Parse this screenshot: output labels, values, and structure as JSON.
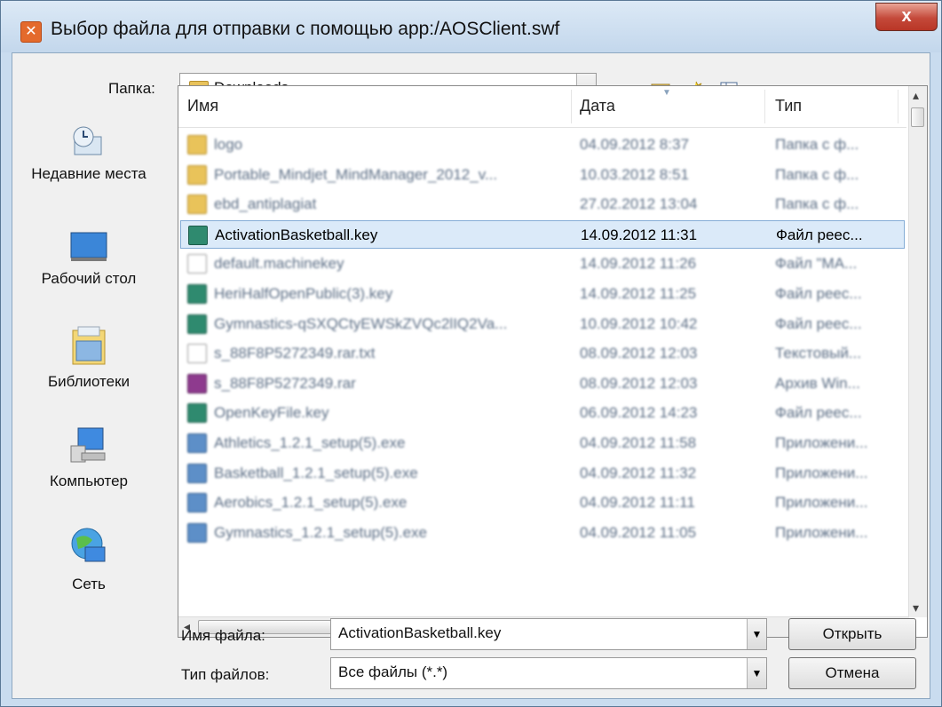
{
  "window": {
    "title": "Выбор файла для отправки с помощью app:/AOSClient.swf",
    "close_glyph": "x"
  },
  "toolbar": {
    "folder_label": "Папка:",
    "folder_value": "Downloads",
    "icons": [
      "back-arrow-icon",
      "up-folder-icon",
      "new-folder-icon",
      "view-menu-icon"
    ]
  },
  "places": [
    {
      "label": "Недавние места",
      "icon": "recent-places-icon"
    },
    {
      "label": "Рабочий стол",
      "icon": "desktop-icon"
    },
    {
      "label": "Библиотеки",
      "icon": "libraries-icon"
    },
    {
      "label": "Компьютер",
      "icon": "computer-icon"
    },
    {
      "label": "Сеть",
      "icon": "network-icon"
    }
  ],
  "columns": {
    "name": "Имя",
    "date": "Дата",
    "type": "Тип"
  },
  "files": [
    {
      "name": "logo",
      "date": "04.09.2012 8:37",
      "type": "Папка с ф...",
      "kind": "folder",
      "selected": false
    },
    {
      "name": "Portable_Mindjet_MindManager_2012_v...",
      "date": "10.03.2012 8:51",
      "type": "Папка с ф...",
      "kind": "folder",
      "selected": false
    },
    {
      "name": "ebd_antiplagiat",
      "date": "27.02.2012 13:04",
      "type": "Папка с ф...",
      "kind": "folder",
      "selected": false
    },
    {
      "name": "ActivationBasketball.key",
      "date": "14.09.2012 11:31",
      "type": "Файл реес...",
      "kind": "reg",
      "selected": true
    },
    {
      "name": "default.machinekey",
      "date": "14.09.2012 11:26",
      "type": "Файл \"MA...",
      "kind": "doc",
      "selected": false
    },
    {
      "name": "HeriHalfOpenPublic(3).key",
      "date": "14.09.2012 11:25",
      "type": "Файл реес...",
      "kind": "reg",
      "selected": false
    },
    {
      "name": "Gymnastics-qSXQCtyEWSkZVQc2lIQ2Va...",
      "date": "10.09.2012 10:42",
      "type": "Файл реес...",
      "kind": "reg",
      "selected": false
    },
    {
      "name": "s_88F8P5272349.rar.txt",
      "date": "08.09.2012 12:03",
      "type": "Текстовый...",
      "kind": "doc",
      "selected": false
    },
    {
      "name": "s_88F8P5272349.rar",
      "date": "08.09.2012 12:03",
      "type": "Архив Win...",
      "kind": "rar",
      "selected": false
    },
    {
      "name": "OpenKeyFile.key",
      "date": "06.09.2012 14:23",
      "type": "Файл реес...",
      "kind": "reg",
      "selected": false
    },
    {
      "name": "Athletics_1.2.1_setup(5).exe",
      "date": "04.09.2012 11:58",
      "type": "Приложени...",
      "kind": "exe",
      "selected": false
    },
    {
      "name": "Basketball_1.2.1_setup(5).exe",
      "date": "04.09.2012 11:32",
      "type": "Приложени...",
      "kind": "exe",
      "selected": false
    },
    {
      "name": "Aerobics_1.2.1_setup(5).exe",
      "date": "04.09.2012 11:11",
      "type": "Приложени...",
      "kind": "exe",
      "selected": false
    },
    {
      "name": "Gymnastics_1.2.1_setup(5).exe",
      "date": "04.09.2012 11:05",
      "type": "Приложени...",
      "kind": "exe",
      "selected": false
    }
  ],
  "scroll": {
    "hthumb_glyph": "III",
    "left": "◂",
    "right": "▸",
    "up": "▴",
    "down": "▾"
  },
  "form": {
    "filename_label": "Имя файла:",
    "filename_value": "ActivationBasketball.key",
    "filetype_label": "Тип файлов:",
    "filetype_value": "Все файлы (*.*)",
    "open_label": "Открыть",
    "cancel_label": "Отмена"
  }
}
